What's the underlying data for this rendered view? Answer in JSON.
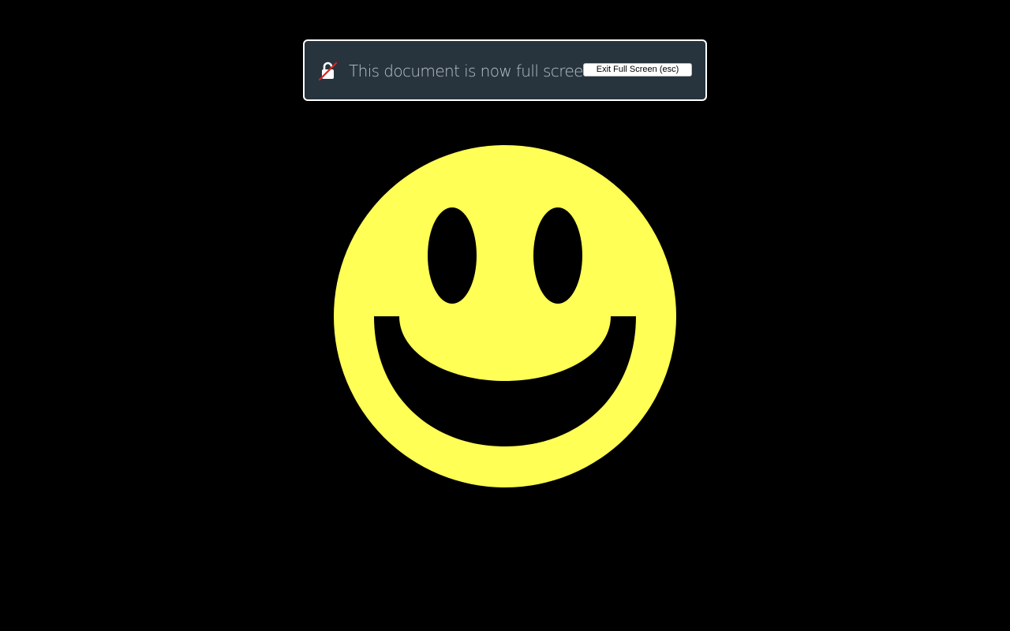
{
  "notice": {
    "message": "This document is now full screen",
    "exit_button_label": "Exit Full Screen (esc)",
    "icon": "unlocked-padlock-icon"
  },
  "content": {
    "image": "smiley-face",
    "face_color": "#ffff55",
    "feature_color": "#000000",
    "background_color": "#000000"
  }
}
